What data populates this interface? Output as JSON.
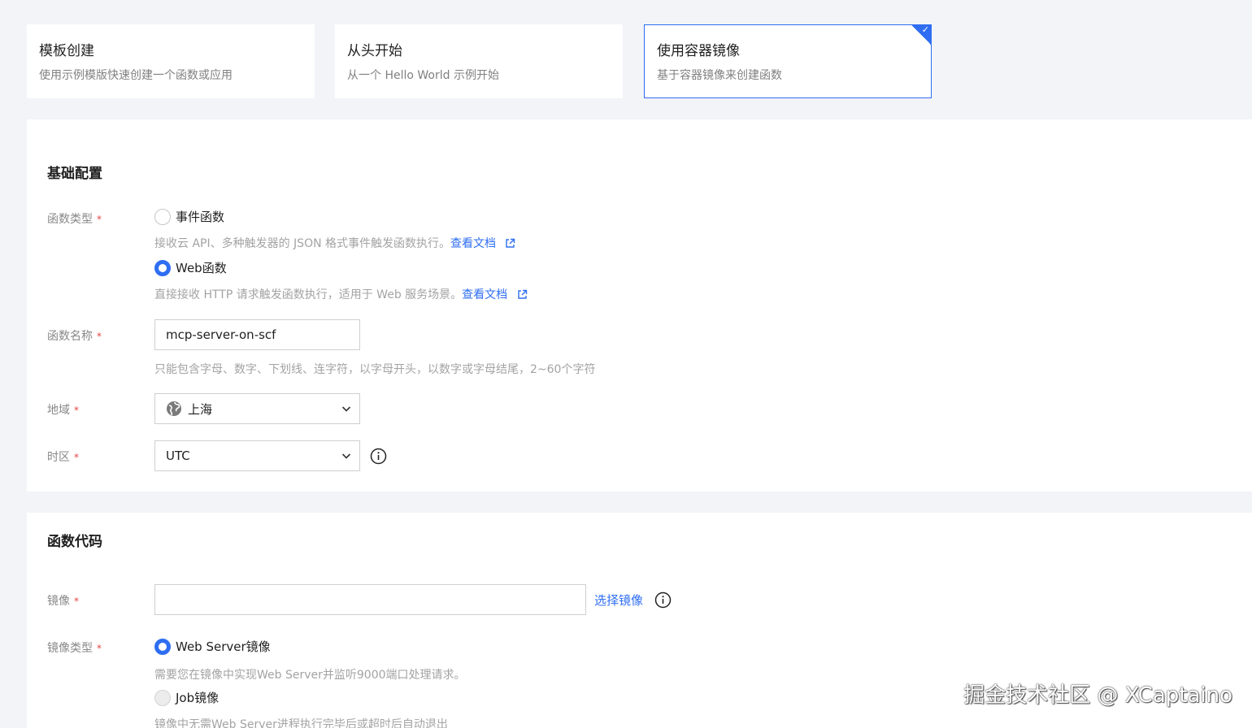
{
  "cards": [
    {
      "title": "模板创建",
      "desc": "使用示例模版快速创建一个函数或应用"
    },
    {
      "title": "从头开始",
      "desc": "从一个 Hello World 示例开始"
    },
    {
      "title": "使用容器镜像",
      "desc": "基于容器镜像来创建函数",
      "selected": true
    }
  ],
  "basic": {
    "title": "基础配置",
    "func_type_label": "函数类型",
    "required_mark": "*",
    "event": {
      "label": "事件函数",
      "help": "接收云 API、多种触发器的 JSON 格式事件触发函数执行。",
      "doc_link": "查看文档"
    },
    "web": {
      "label": "Web函数",
      "help": "直接接收 HTTP 请求触发函数执行，适用于 Web 服务场景。",
      "doc_link": "查看文档"
    },
    "name_label": "函数名称",
    "name_value": "mcp-server-on-scf",
    "name_help": "只能包含字母、数字、下划线、连字符，以字母开头，以数字或字母结尾，2~60个字符",
    "region_label": "地域",
    "region_value": "上海",
    "tz_label": "时区",
    "tz_value": "UTC"
  },
  "code": {
    "title": "函数代码",
    "image_label": "镜像",
    "image_value": "",
    "select_image": "选择镜像",
    "image_type_label": "镜像类型",
    "web_server": {
      "label": "Web Server镜像",
      "help": "需要您在镜像中实现Web Server并监听9000端口处理请求。"
    },
    "job": {
      "label": "Job镜像",
      "help": "镜像中无需Web Server进程执行完毕后或超时后自动退出"
    }
  },
  "watermark": "掘金技术社区 @ XCaptaino",
  "colors": {
    "accent": "#2f6ef2",
    "required": "#e54545"
  }
}
